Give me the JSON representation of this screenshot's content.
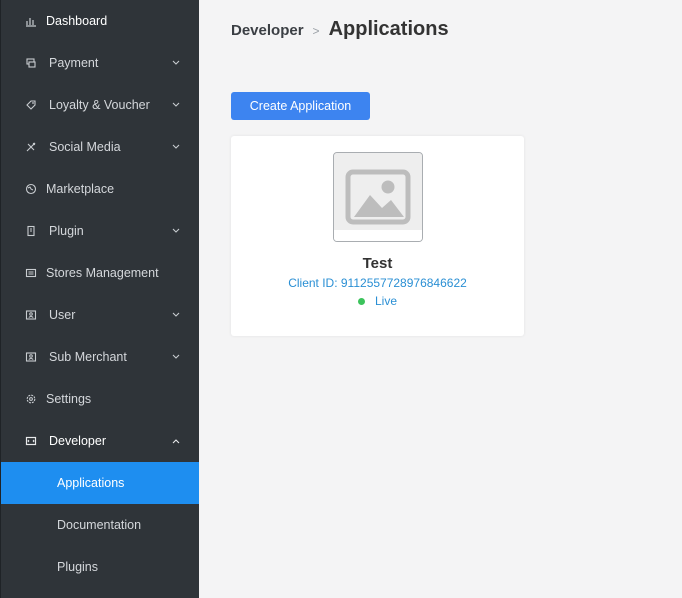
{
  "sidebar": {
    "items": [
      {
        "label": "Dashboard",
        "icon": "dashboard-icon",
        "expandable": false
      },
      {
        "label": "Payment",
        "icon": "payment-icon",
        "expandable": true
      },
      {
        "label": "Loyalty & Voucher",
        "icon": "tag-icon",
        "expandable": true
      },
      {
        "label": "Social Media",
        "icon": "social-icon",
        "expandable": true
      },
      {
        "label": "Marketplace",
        "icon": "globe-icon",
        "expandable": false
      },
      {
        "label": "Plugin",
        "icon": "plugin-icon",
        "expandable": true
      },
      {
        "label": "Stores Management",
        "icon": "store-icon",
        "expandable": false
      },
      {
        "label": "User",
        "icon": "user-icon",
        "expandable": true
      },
      {
        "label": "Sub Merchant",
        "icon": "merchant-icon",
        "expandable": true
      },
      {
        "label": "Settings",
        "icon": "gear-icon",
        "expandable": false
      },
      {
        "label": "Developer",
        "icon": "developer-icon",
        "expandable": true,
        "expanded": true
      }
    ],
    "developer_subitems": [
      {
        "label": "Applications",
        "active": true
      },
      {
        "label": "Documentation",
        "active": false
      },
      {
        "label": "Plugins",
        "active": false
      }
    ]
  },
  "breadcrumb": {
    "parent": "Developer",
    "separator": ">",
    "current": "Applications"
  },
  "toolbar": {
    "create_label": "Create Application"
  },
  "applications": [
    {
      "name": "Test",
      "client_id_text": "Client ID: 9112557728976846622",
      "status": "Live",
      "status_color": "#3cc35c",
      "thumbnail_icon": "image-placeholder-icon"
    }
  ],
  "colors": {
    "sidebar_bg": "#2f3439",
    "active_bg": "#1e8ef0",
    "button_bg": "#3d84f0",
    "link": "#2a8fd4",
    "page_bg": "#f4f4f5"
  }
}
